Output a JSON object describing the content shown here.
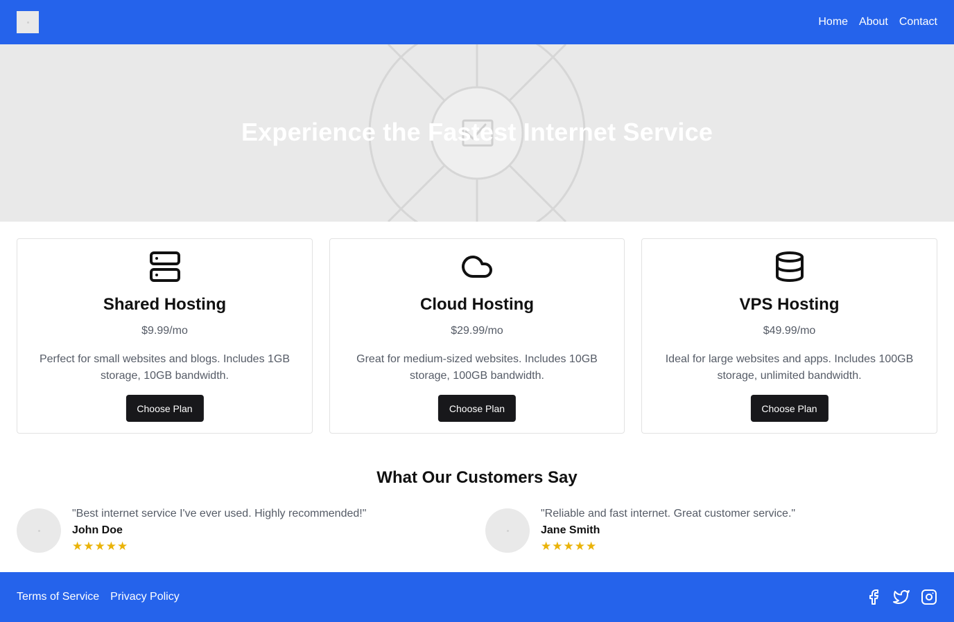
{
  "header": {
    "logo_icon": "image-placeholder-icon",
    "nav": [
      "Home",
      "About",
      "Contact"
    ]
  },
  "hero": {
    "title": "Experience the Fastest Internet Service",
    "background_icon": "image-placeholder-icon"
  },
  "plans": [
    {
      "icon": "server-icon",
      "name": "Shared Hosting",
      "price": "$9.99/mo",
      "description": "Perfect for small websites and blogs. Includes 1GB storage, 10GB bandwidth.",
      "button": "Choose Plan"
    },
    {
      "icon": "cloud-icon",
      "name": "Cloud Hosting",
      "price": "$29.99/mo",
      "description": "Great for medium-sized websites. Includes 10GB storage, 100GB bandwidth.",
      "button": "Choose Plan"
    },
    {
      "icon": "database-icon",
      "name": "VPS Hosting",
      "price": "$49.99/mo",
      "description": "Ideal for large websites and apps. Includes 100GB storage, unlimited bandwidth.",
      "button": "Choose Plan"
    }
  ],
  "testimonials": {
    "title": "What Our Customers Say",
    "items": [
      {
        "quote": "\"Best internet service I've ever used. Highly recommended!\"",
        "name": "John Doe",
        "stars": "★★★★★",
        "rating": 5
      },
      {
        "quote": "\"Reliable and fast internet. Great customer service.\"",
        "name": "Jane Smith",
        "stars": "★★★★★",
        "rating": 5
      }
    ]
  },
  "footer": {
    "links": [
      "Terms of Service",
      "Privacy Policy"
    ],
    "social": [
      "facebook-icon",
      "twitter-icon",
      "instagram-icon"
    ]
  },
  "colors": {
    "brand": "#2563eb",
    "button": "#18181b",
    "star": "#eab308",
    "muted_text": "#555b66"
  }
}
